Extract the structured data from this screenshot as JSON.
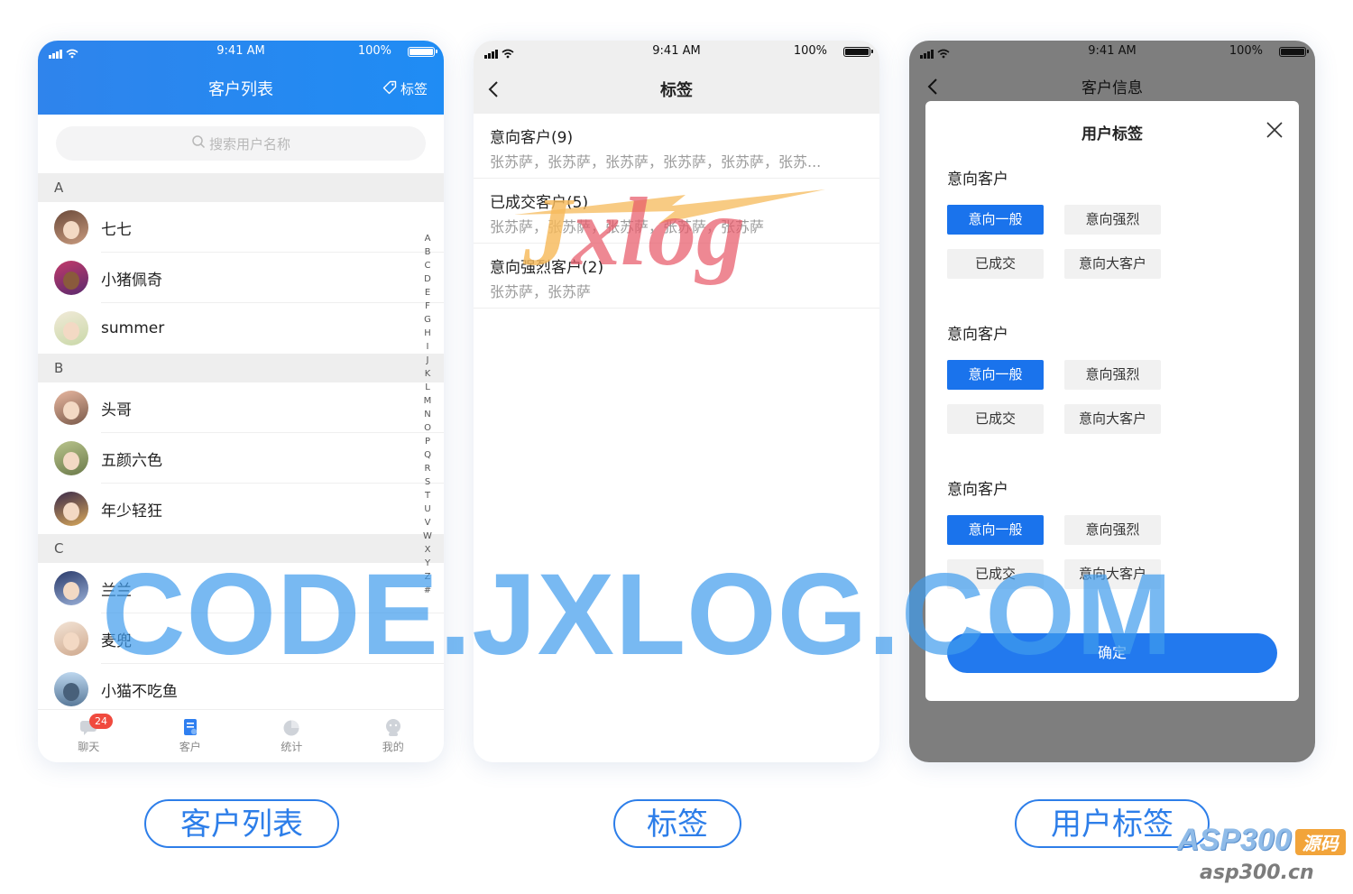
{
  "status": {
    "time": "9:41 AM",
    "battery": "100%"
  },
  "customers": {
    "title": "客户列表",
    "tag_button": "标签",
    "search_placeholder": "搜索用户名称",
    "sections": [
      {
        "letter": "A",
        "items": [
          "七七",
          "小猪佩奇",
          "summer"
        ]
      },
      {
        "letter": "B",
        "items": [
          "头哥",
          "五颜六色",
          "年少轻狂"
        ]
      },
      {
        "letter": "C",
        "items": [
          "兰兰",
          "麦兜",
          "小猫不吃鱼"
        ]
      }
    ],
    "index_letters": [
      "A",
      "B",
      "C",
      "D",
      "E",
      "F",
      "G",
      "H",
      "I",
      "J",
      "K",
      "L",
      "M",
      "N",
      "O",
      "P",
      "Q",
      "R",
      "S",
      "T",
      "U",
      "V",
      "W",
      "X",
      "Y",
      "Z",
      "#"
    ],
    "tabs": [
      {
        "label": "聊天",
        "badge": "24"
      },
      {
        "label": "客户"
      },
      {
        "label": "统计"
      },
      {
        "label": "我的"
      }
    ]
  },
  "tags": {
    "title": "标签",
    "items": [
      {
        "title": "意向客户(9)",
        "members": "张苏萨，张苏萨，张苏萨，张苏萨，张苏萨，张苏..."
      },
      {
        "title": "已成交客户(5)",
        "members": "张苏萨，张苏萨，张苏萨，张苏萨，张苏萨"
      },
      {
        "title": "意向强烈客户(2)",
        "members": "张苏萨，张苏萨"
      }
    ]
  },
  "user_tags": {
    "page_title": "客户信息",
    "modal_title": "用户标签",
    "groups": [
      {
        "title": "意向客户",
        "options": [
          "意向一般",
          "意向强烈",
          "已成交",
          "意向大客户"
        ]
      },
      {
        "title": "意向客户",
        "options": [
          "意向一般",
          "意向强烈",
          "已成交",
          "意向大客户"
        ]
      },
      {
        "title": "意向客户",
        "options": [
          "意向一般",
          "意向强烈",
          "已成交",
          "意向大客户"
        ]
      }
    ],
    "confirm": "确定"
  },
  "captions": [
    "客户列表",
    "标签",
    "用户标签"
  ],
  "watermarks": {
    "big": "CODE.JXLOG.COM",
    "logo_j": "J",
    "logo_rest": "xlog",
    "asp": "ASP300",
    "asp_tag": "源码",
    "asp_url": "asp300.cn"
  },
  "colors": {
    "accent": "#1f8cf4",
    "selected_chip": "#1a73ec",
    "badge": "#f04a3e",
    "overlay": "#7e7e7e"
  }
}
